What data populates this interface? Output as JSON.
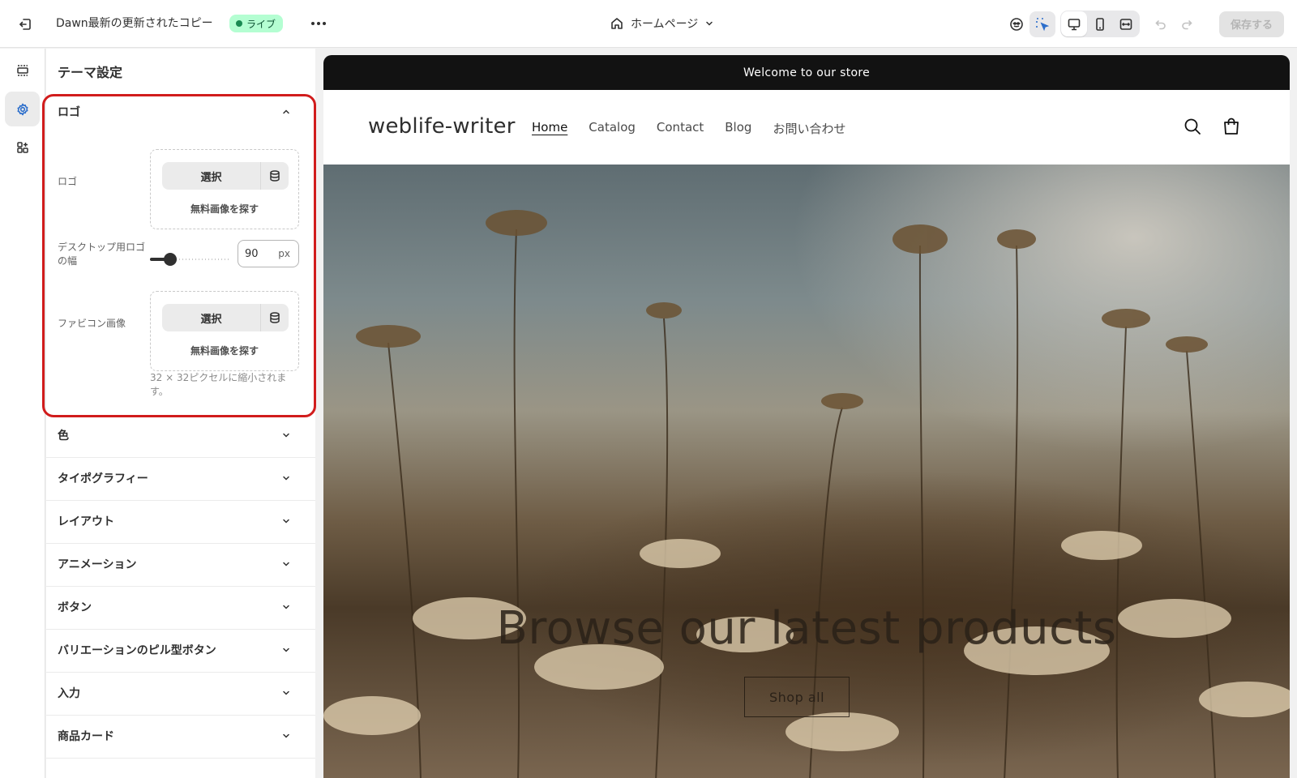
{
  "topbar": {
    "theme_title": "Dawn最新の更新されたコピー",
    "status_badge": "ライブ",
    "page_selector": "ホームページ",
    "save_label": "保存する"
  },
  "panel": {
    "title": "テーマ設定",
    "logo_section": {
      "title": "ロゴ",
      "logo_label": "ロゴ",
      "select_label": "選択",
      "free_images_link": "無料画像を探す",
      "width_label": "デスクトップ用ロゴの幅",
      "width_value": "90",
      "width_unit": "px",
      "width_slider_fraction": 0.2,
      "favicon_label": "ファビコン画像",
      "favicon_help": "32 × 32ピクセルに縮小されます。"
    },
    "sections": [
      "色",
      "タイポグラフィー",
      "レイアウト",
      "アニメーション",
      "ボタン",
      "バリエーションのピル型ボタン",
      "入力",
      "商品カード"
    ]
  },
  "preview": {
    "announcement": "Welcome to our store",
    "brand": "weblife-writer",
    "nav": [
      "Home",
      "Catalog",
      "Contact",
      "Blog",
      "お問い合わせ"
    ],
    "hero_title": "Browse our latest products",
    "hero_button": "Shop all"
  },
  "colors": {
    "live_badge_bg": "#b4fed2",
    "highlight_border": "#d11c1c",
    "announcement_bg": "#121212"
  }
}
